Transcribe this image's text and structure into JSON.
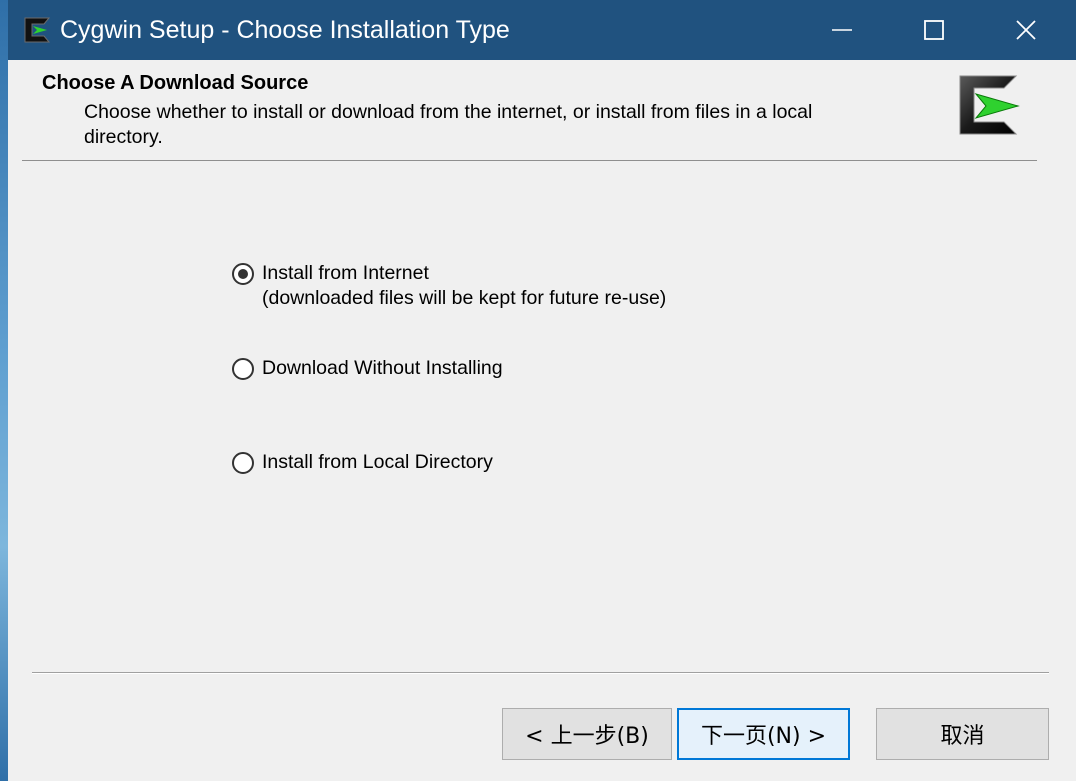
{
  "window": {
    "title": "Cygwin Setup - Choose Installation Type"
  },
  "header": {
    "title": "Choose A Download Source",
    "description": "Choose whether to install or download from the internet, or install from files in a local directory."
  },
  "options": [
    {
      "label_line1": "Install from Internet",
      "label_line2": "(downloaded files will be kept for future re-use)",
      "selected": true
    },
    {
      "label_line1": "Download Without Installing",
      "selected": false
    },
    {
      "label_line1": "Install from Local Directory",
      "selected": false
    }
  ],
  "buttons": {
    "back": "< 上一步(B)",
    "next": "下一页(N) >",
    "cancel": "取消"
  },
  "colors": {
    "titlebar": "#20527f",
    "window_bg": "#f0f0f0",
    "logo_green": "#2fd12f",
    "default_button_border": "#0078d7"
  },
  "icons": {
    "app": "cygwin-logo-icon",
    "minimize": "minimize-icon",
    "maximize": "maximize-icon",
    "close": "close-icon"
  }
}
